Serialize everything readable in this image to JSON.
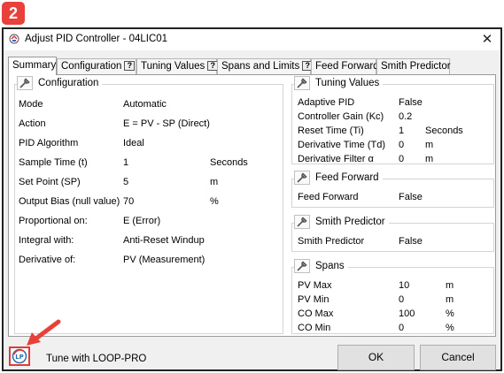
{
  "step_badge": "2",
  "window": {
    "title": "Adjust PID Controller - 04LIC01",
    "close": "✕"
  },
  "tabs": [
    {
      "label": "Summary",
      "help": ""
    },
    {
      "label": "Configuration",
      "help": "?"
    },
    {
      "label": "Tuning Values",
      "help": "?"
    },
    {
      "label": "Spans and Limits",
      "help": "?"
    },
    {
      "label": "Feed Forward",
      "help": ""
    },
    {
      "label": "Smith Predictor",
      "help": ""
    }
  ],
  "configuration": {
    "title": "Configuration",
    "rows": [
      {
        "label": "Mode",
        "value": "Automatic",
        "unit": ""
      },
      {
        "label": "Action",
        "value": "E = PV - SP (Direct)",
        "unit": ""
      },
      {
        "label": "PID Algorithm",
        "value": "Ideal",
        "unit": ""
      },
      {
        "label": "Sample Time (t)",
        "value": "1",
        "unit": "Seconds"
      },
      {
        "label": "Set Point (SP)",
        "value": "5",
        "unit": "m"
      },
      {
        "label": "Output Bias (null value)",
        "value": "70",
        "unit": "%"
      },
      {
        "label": "Proportional on:",
        "value": "E (Error)",
        "unit": ""
      },
      {
        "label": "Integral with:",
        "value": "Anti-Reset Windup",
        "unit": ""
      },
      {
        "label": "Derivative of:",
        "value": "PV (Measurement)",
        "unit": ""
      }
    ]
  },
  "tuning_values": {
    "title": "Tuning Values",
    "rows": [
      {
        "label": "Adaptive PID",
        "value": "False",
        "unit": ""
      },
      {
        "label": "Controller Gain (Kc)",
        "value": "0.2",
        "unit": ""
      },
      {
        "label": "Reset Time (Ti)",
        "value": "1",
        "unit": "Seconds"
      },
      {
        "label": "Derivative Time (Td)",
        "value": "0",
        "unit": "m"
      },
      {
        "label": "Derivative Filter α",
        "value": "0",
        "unit": "m"
      }
    ]
  },
  "feed_forward": {
    "title": "Feed Forward",
    "rows": [
      {
        "label": "Feed Forward",
        "value": "False",
        "unit": ""
      }
    ]
  },
  "smith_predictor": {
    "title": "Smith Predictor",
    "rows": [
      {
        "label": "Smith Predictor",
        "value": "False",
        "unit": ""
      }
    ]
  },
  "spans": {
    "title": "Spans",
    "rows": [
      {
        "label": "PV Max",
        "value": "10",
        "unit": "m"
      },
      {
        "label": "PV Min",
        "value": "0",
        "unit": "m"
      },
      {
        "label": "CO Max",
        "value": "100",
        "unit": "%"
      },
      {
        "label": "CO Min",
        "value": "0",
        "unit": "%"
      }
    ]
  },
  "footer": {
    "loop_icon_text": "LP",
    "tune_label": "Tune with LOOP-PRO",
    "ok_label": "OK",
    "cancel_label": "Cancel"
  },
  "colors": {
    "highlight_red": "#e8413c",
    "window_bg": "#f0f0f0",
    "border_dark": "#222222"
  }
}
